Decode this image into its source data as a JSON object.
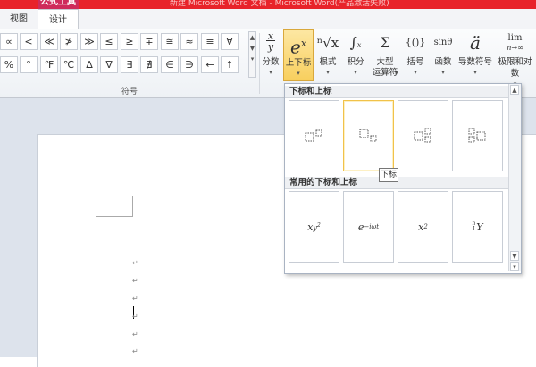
{
  "window": {
    "title": "新建 Microsoft Word 文档 - Microsoft Word(产品激活失败)",
    "context_tab": "公式工具"
  },
  "tabs": {
    "view": "视图",
    "design": "设计"
  },
  "symbols": {
    "row1": [
      "∝",
      "<",
      "≪",
      "≯",
      "≫",
      "≤",
      "≥",
      "∓",
      "≅",
      "≈",
      "≡",
      "∀"
    ],
    "row2": [
      "%",
      "°",
      "℉",
      "℃",
      "∆",
      "∇",
      "∃",
      "∄",
      "∈",
      "∋",
      "←",
      "↑"
    ],
    "scroll_glyphs": [
      "▲",
      "▼",
      "▾"
    ],
    "group_label": "符号"
  },
  "structures": {
    "fraction": {
      "glyph": "x/y",
      "label": "分数"
    },
    "script": {
      "glyph": "eˣ",
      "label": "上下标"
    },
    "radical": {
      "glyph": "ⁿ√x",
      "label": "根式"
    },
    "integral": {
      "glyph": "∫",
      "label": "积分"
    },
    "large_operator": {
      "glyph": "Σ",
      "label": "大型",
      "label2": "运算符"
    },
    "bracket": {
      "glyph": "{()}",
      "label": "括号"
    },
    "function": {
      "glyph": "sinθ",
      "label": "函数"
    },
    "accent": {
      "glyph": "ä",
      "label": "导数符号"
    },
    "limit_log": {
      "glyph": "lim",
      "sub": "n→∞",
      "label": "极限和对数"
    },
    "arrow": "▾"
  },
  "gallery": {
    "section1": "下标和上标",
    "section2": "常用的下标和上标",
    "common": [
      "x_{y²}",
      "e^{−iωt}",
      "x²",
      "ⁿ₁Y"
    ],
    "common_display": [
      "xy²",
      "e−iωt",
      "x²",
      "ⁿ₁Y"
    ],
    "tooltip": "下标",
    "scroll": {
      "up": "▲",
      "down": "▼",
      "more": "▾"
    }
  },
  "document": {
    "para_mark": "↵"
  }
}
